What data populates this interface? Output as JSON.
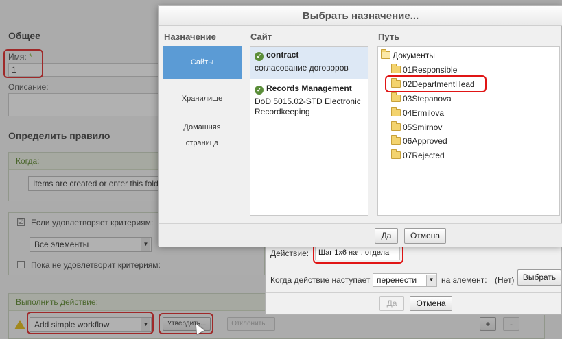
{
  "rule_page": {
    "section_general": "Общее",
    "name_label": "Имя:",
    "required_mark": "*",
    "name_value": "1",
    "description_label": "Описание:",
    "section_define_rule": "Определить правило",
    "when_label": "Когда:",
    "when_value": "Items are created or enter this fold",
    "if_criteria_label": "Если удовлетворяет критериям:",
    "if_criteria_checked": "☑",
    "criteria_select": "Все элементы",
    "unless_label": "Пока не удовлетворит критериям:",
    "perform_action_label": "Выполнить действие:",
    "action_select": "Add simple workflow",
    "approve_button": "Утвердить...",
    "reject_button": "Отклонить...",
    "plus_button": "+",
    "minus_button": "-",
    "warning_icon_glyph": "!"
  },
  "action_dialog": {
    "action_label": "Действие:",
    "action_value": "Шаг 1х6 нач. отдела",
    "when_label": "Когда действие наступает",
    "when_select": "перенести",
    "to_element_label": "на элемент:",
    "none_value": "(Нет)",
    "choose_button": "Выбрать",
    "ok_button": "Да",
    "cancel_button": "Отмена"
  },
  "dialog": {
    "title": "Выбрать назначение...",
    "col_destination": "Назначение",
    "col_site": "Сайт",
    "col_path": "Путь",
    "destinations": [
      {
        "label": "Сайты"
      },
      {
        "label": "Хранилище"
      },
      {
        "label": "Домашняя"
      },
      {
        "label": "страница"
      }
    ],
    "sites": [
      {
        "name": "contract",
        "description": "согласование договоров"
      },
      {
        "name": "Records Management",
        "description": "DoD 5015.02-STD Electronic Recordkeeping"
      }
    ],
    "path_root": "Документы",
    "folders": [
      "01Responsible",
      "02DepartmentHead",
      "03Stepanova",
      "04Ermilova",
      "05Smirnov",
      "06Approved",
      "07Rejected"
    ],
    "selected_folder": "02DepartmentHead",
    "ok_button": "Да",
    "cancel_button": "Отмена"
  },
  "colors": {
    "accent_blue": "#5b9bd5",
    "highlight_red": "#e01515",
    "panel_green": "#4e7e1a"
  }
}
